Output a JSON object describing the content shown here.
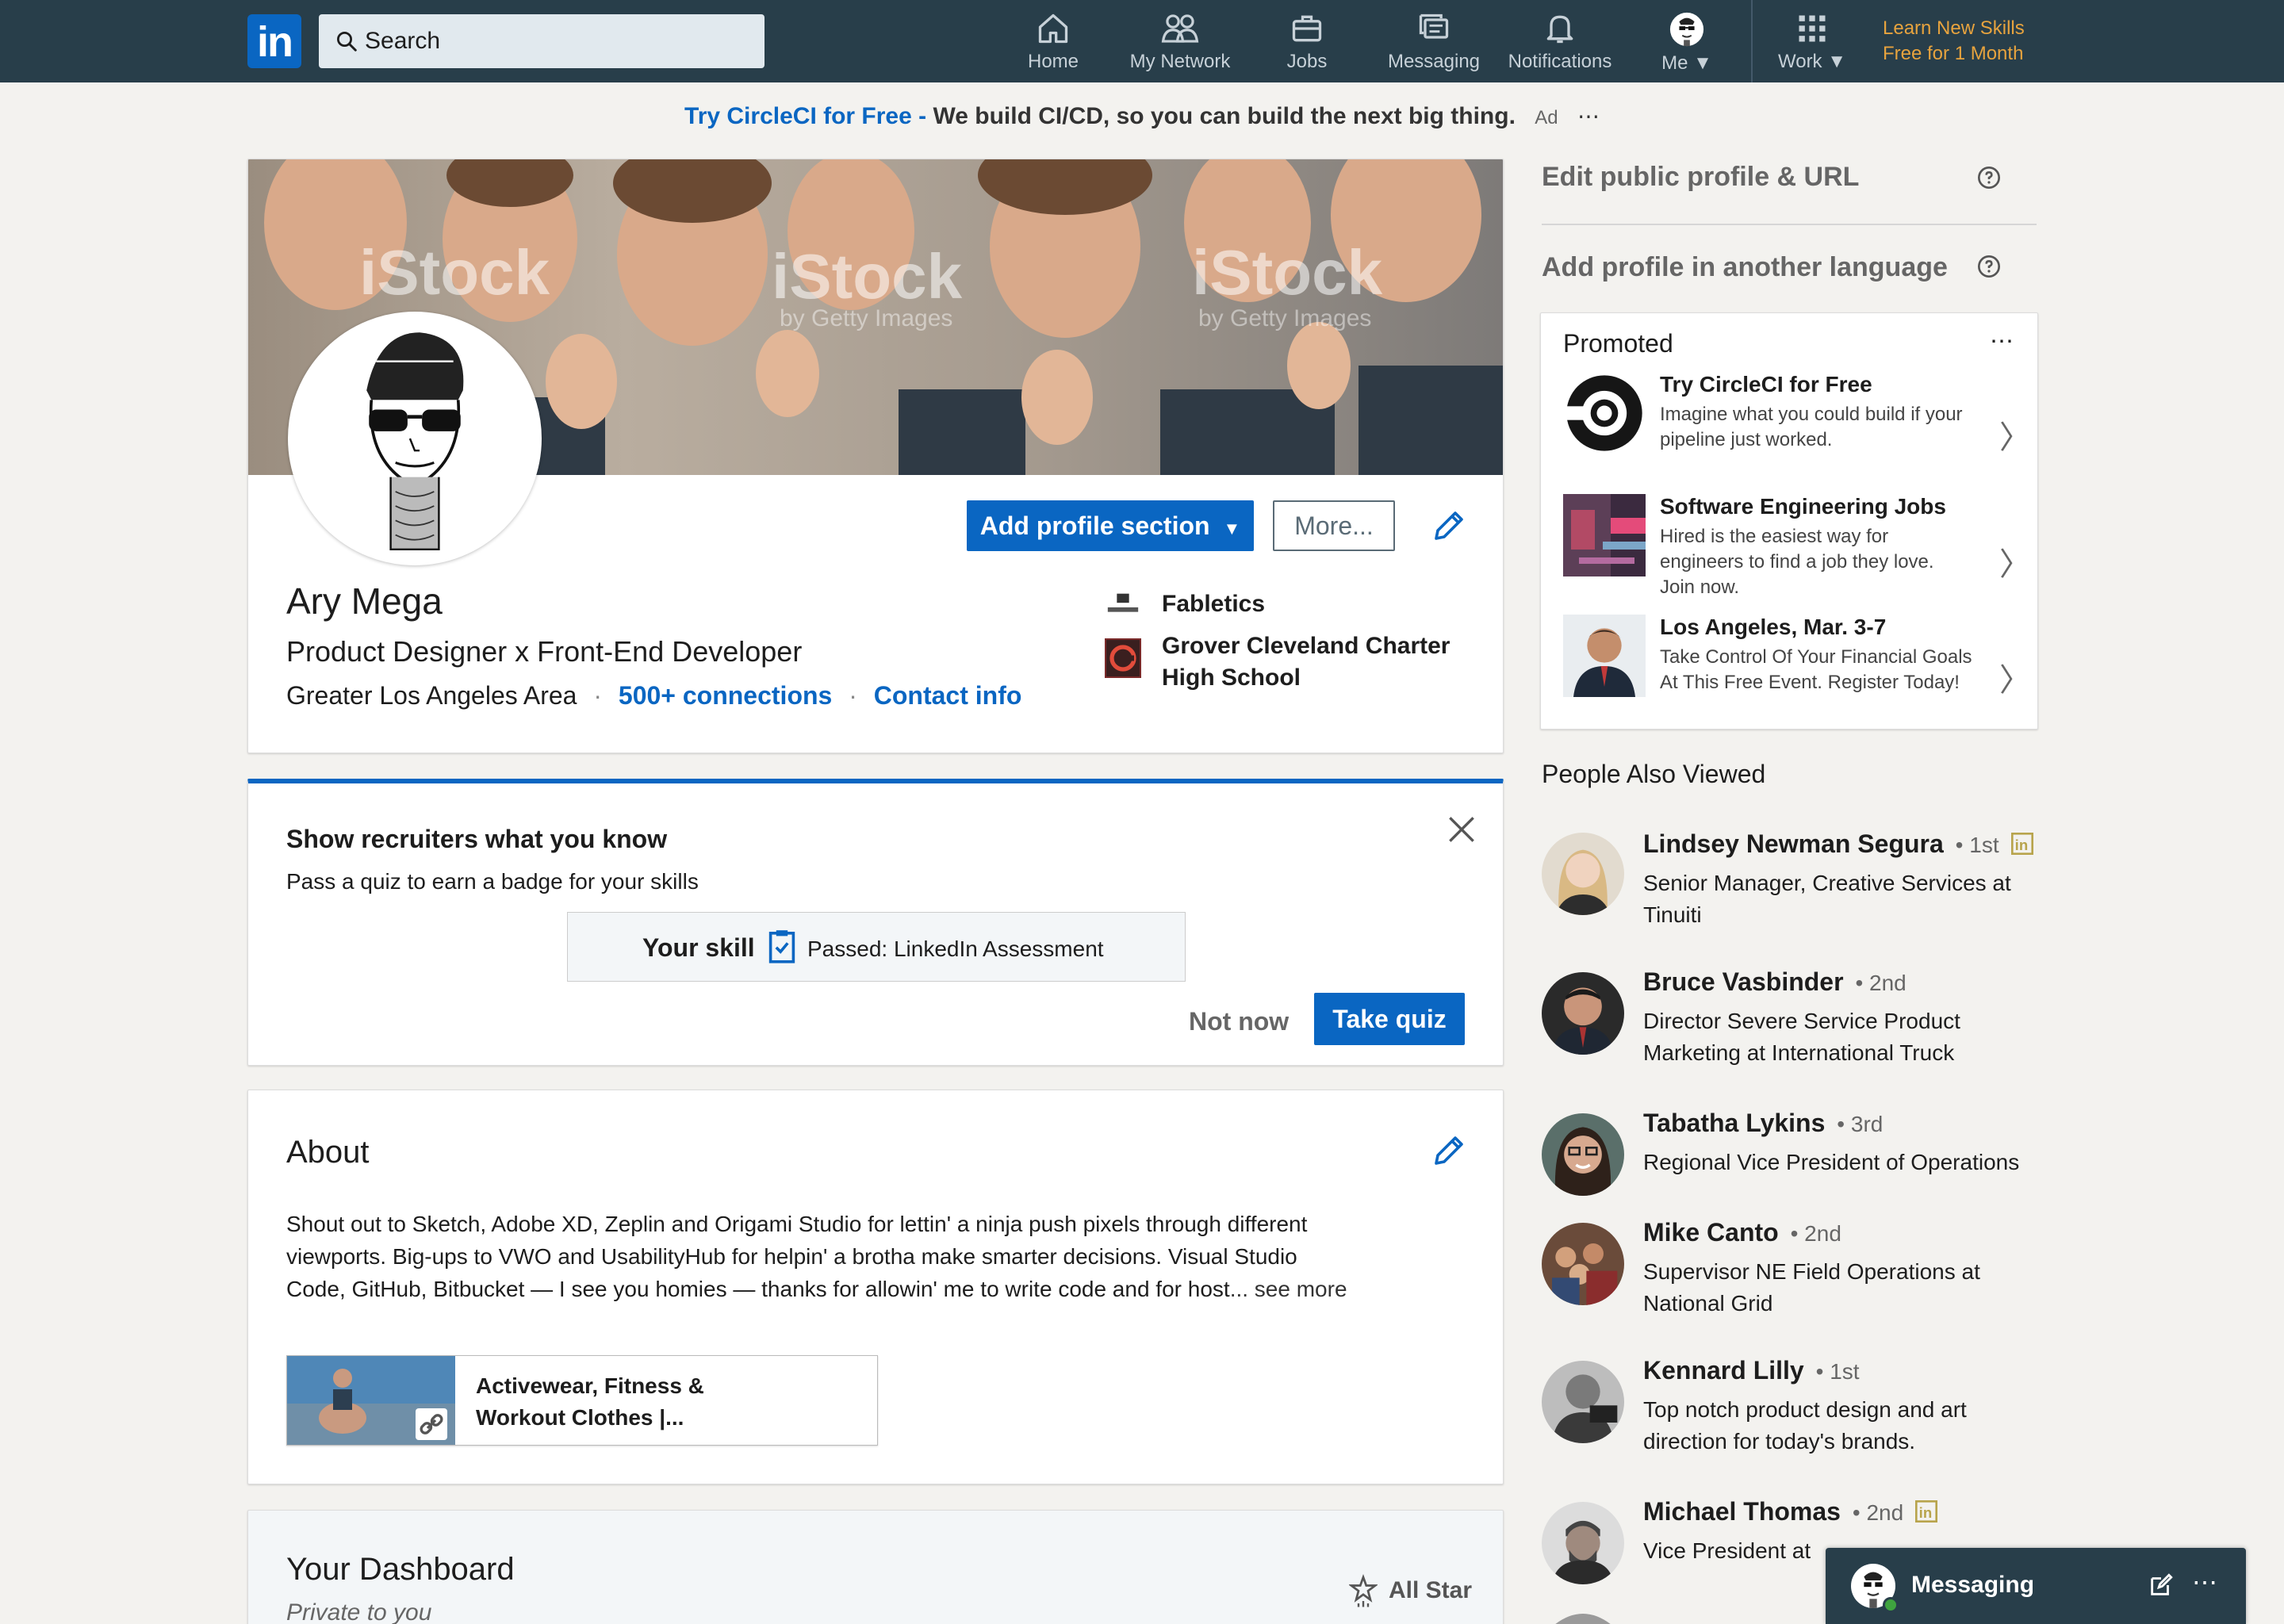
{
  "nav": {
    "search_placeholder": "Search",
    "items": [
      {
        "label": "Home",
        "icon": "home-icon"
      },
      {
        "label": "My Network",
        "icon": "network-icon"
      },
      {
        "label": "Jobs",
        "icon": "briefcase-icon"
      },
      {
        "label": "Messaging",
        "icon": "chat-icon"
      },
      {
        "label": "Notifications",
        "icon": "bell-icon"
      },
      {
        "label": "Me",
        "icon": "avatar-icon"
      },
      {
        "label": "Work",
        "icon": "grid-icon"
      }
    ],
    "learn_line1": "Learn New Skills",
    "learn_line2": "Free for 1 Month",
    "logo_text": "in"
  },
  "ad": {
    "link": "Try CircleCI for Free - ",
    "text": "We build CI/CD, so you can build the next big thing.",
    "tag": "Ad",
    "more": "⋯"
  },
  "profile": {
    "name": "Ary Mega",
    "headline": "Product Designer x Front-End Developer",
    "location": "Greater Los Angeles Area",
    "connections": "500+ connections",
    "contact": "Contact info",
    "dot": "·",
    "add_section": "Add profile section",
    "more": "More...",
    "company": "Fabletics",
    "school_line1": "Grover Cleveland Charter",
    "school_line2": "High School",
    "banner_watermark": "iStock",
    "banner_sub": "by Getty Images"
  },
  "recruiters": {
    "title": "Show recruiters what you know",
    "subtitle": "Pass a quiz to earn a badge for your skills",
    "skill_label": "Your skill",
    "passed": "Passed: LinkedIn Assessment",
    "not_now": "Not now",
    "take_quiz": "Take quiz"
  },
  "about": {
    "title": "About",
    "line1": "Shout out to Sketch, Adobe XD, Zeplin and Origami Studio for lettin' a ninja push pixels through different",
    "line2": "viewports. Big-ups to VWO and UsabilityHub for helpin' a brotha make smarter decisions. Visual Studio",
    "line3": "Code, GitHub, Bitbucket — I see you homies — thanks for allowin' me to write code and for host",
    "see_more": "... see more",
    "media_line1": "Activewear, Fitness &",
    "media_line2": "Workout Clothes |..."
  },
  "dashboard": {
    "title": "Your Dashboard",
    "subtitle": "Private to you",
    "all_star": "All Star"
  },
  "sidebar": {
    "edit_public": "Edit public profile & URL",
    "add_language": "Add profile in another language",
    "promoted": {
      "title": "Promoted",
      "more": "⋯",
      "items": [
        {
          "title": "Try CircleCI for Free",
          "desc1": "Imagine what you could build if your",
          "desc2": "pipeline just worked.",
          "desc3": ""
        },
        {
          "title": "Software Engineering Jobs",
          "desc1": "Hired is the easiest way for",
          "desc2": "engineers to find a job they love.",
          "desc3": "Join now."
        },
        {
          "title": "Los Angeles, Mar. 3-7",
          "desc1": "Take Control Of Your Financial Goals",
          "desc2": "At This Free Event. Register Today!",
          "desc3": ""
        }
      ]
    },
    "pav_title": "People Also Viewed",
    "people": [
      {
        "name": "Lindsey Newman Segura",
        "degree": "1st",
        "l1": "Senior Manager, Creative Services at",
        "l2": "Tinuiti",
        "premium": true
      },
      {
        "name": "Bruce Vasbinder",
        "degree": "2nd",
        "l1": "Director Severe Service Product",
        "l2": "Marketing at International Truck",
        "premium": false
      },
      {
        "name": "Tabatha Lykins",
        "degree": "3rd",
        "l1": "Regional Vice President of Operations",
        "l2": "",
        "premium": false
      },
      {
        "name": "Mike Canto",
        "degree": "2nd",
        "l1": "Supervisor NE Field Operations at",
        "l2": "National Grid",
        "premium": false
      },
      {
        "name": "Kennard Lilly",
        "degree": "1st",
        "l1": "Top notch product design and art",
        "l2": "direction for today's brands.",
        "premium": false
      },
      {
        "name": "Michael Thomas",
        "degree": "2nd",
        "l1": "Vice President at",
        "l2": "",
        "premium": true
      }
    ],
    "degree_dot": "•"
  },
  "messaging": {
    "label": "Messaging"
  },
  "colors": {
    "nav_bg": "#283e4a",
    "brand_blue": "#0a66c2",
    "learn_gold": "#e7a33e",
    "premium_gold": "#b8a44c"
  }
}
